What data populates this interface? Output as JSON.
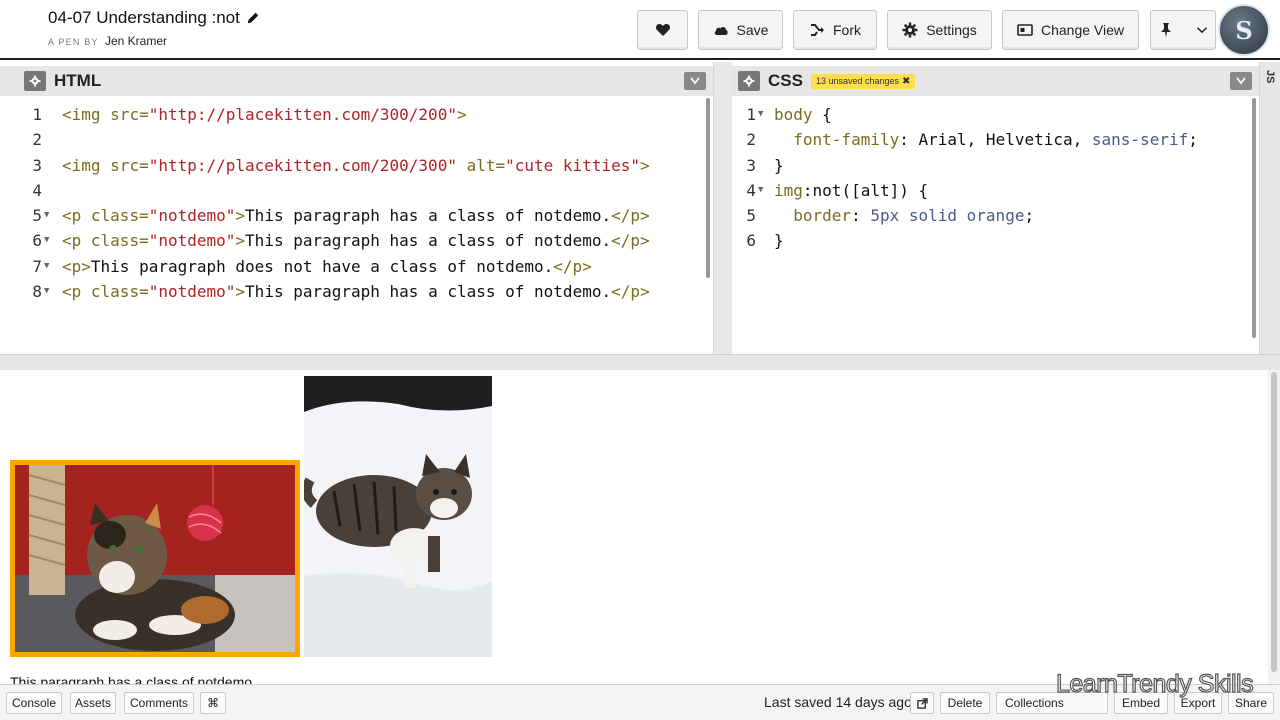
{
  "pen": {
    "title": "04-07 Understanding :not",
    "byline_prefix": "A PEN BY",
    "author": "Jen Kramer"
  },
  "header_buttons": {
    "save": "Save",
    "fork": "Fork",
    "settings": "Settings",
    "change_view": "Change View"
  },
  "avatar_text": "S",
  "html_editor": {
    "title": "HTML",
    "lines": [
      {
        "n": "1",
        "segments": [
          [
            "tag",
            "<img "
          ],
          [
            "attr",
            "src="
          ],
          [
            "str",
            "\"http://placekitten.com/300/200\""
          ],
          [
            "tag",
            ">"
          ]
        ]
      },
      {
        "n": "2",
        "segments": []
      },
      {
        "n": "3",
        "segments": [
          [
            "tag",
            "<img "
          ],
          [
            "attr",
            "src="
          ],
          [
            "str",
            "\"http://placekitten.com/200/300\""
          ],
          [
            "attr",
            " alt="
          ],
          [
            "str",
            "\"cute kitties\""
          ],
          [
            "tag",
            ">"
          ]
        ]
      },
      {
        "n": "4",
        "segments": []
      },
      {
        "n": "5",
        "segments": [
          [
            "tag",
            "<p "
          ],
          [
            "attr",
            "class="
          ],
          [
            "str",
            "\"notdemo\""
          ],
          [
            "tag",
            ">"
          ],
          [
            "plain",
            "This paragraph has a class of notdemo."
          ],
          [
            "tag",
            "</p>"
          ]
        ]
      },
      {
        "n": "6",
        "segments": [
          [
            "tag",
            "<p "
          ],
          [
            "attr",
            "class="
          ],
          [
            "str",
            "\"notdemo\""
          ],
          [
            "tag",
            ">"
          ],
          [
            "plain",
            "This paragraph has a class of notdemo."
          ],
          [
            "tag",
            "</p>"
          ]
        ]
      },
      {
        "n": "7",
        "segments": [
          [
            "tag",
            "<p>"
          ],
          [
            "plain",
            "This paragraph does not have a class of notdemo."
          ],
          [
            "tag",
            "</p>"
          ]
        ]
      },
      {
        "n": "8",
        "segments": [
          [
            "tag",
            "<p "
          ],
          [
            "attr",
            "class="
          ],
          [
            "str",
            "\"notdemo\""
          ],
          [
            "tag",
            ">"
          ],
          [
            "plain",
            "This paragraph has a class of notdemo."
          ],
          [
            "tag",
            "</p>"
          ]
        ]
      }
    ]
  },
  "css_editor": {
    "title": "CSS",
    "unsaved_badge": "13 unsaved changes",
    "lines": [
      {
        "n": "1",
        "segments": [
          [
            "sel",
            "body"
          ],
          [
            "plain",
            " {"
          ]
        ]
      },
      {
        "n": "2",
        "segments": [
          [
            "plain",
            "  "
          ],
          [
            "prop",
            "font-family"
          ],
          [
            "plain",
            ": Arial, Helvetica, "
          ],
          [
            "val",
            "sans-serif"
          ],
          [
            "plain",
            ";"
          ]
        ]
      },
      {
        "n": "3",
        "segments": [
          [
            "plain",
            "}"
          ]
        ]
      },
      {
        "n": "4",
        "segments": [
          [
            "sel",
            "img"
          ],
          [
            "plain",
            ":not([alt]) {"
          ]
        ]
      },
      {
        "n": "5",
        "segments": [
          [
            "plain",
            "  "
          ],
          [
            "prop",
            "border"
          ],
          [
            "plain",
            ": "
          ],
          [
            "val",
            "5px solid orange"
          ],
          [
            "plain",
            ";"
          ]
        ]
      },
      {
        "n": "6",
        "segments": [
          [
            "plain",
            "}"
          ]
        ]
      }
    ]
  },
  "js_tab": "JS",
  "preview": {
    "paragraph": "This paragraph has a class of notdemo."
  },
  "footer": {
    "console": "Console",
    "assets": "Assets",
    "comments": "Comments",
    "shortcut": "⌘",
    "last_saved": "Last saved 14 days ago",
    "delete": "Delete",
    "collections": "Collections",
    "embed": "Embed",
    "export": "Export",
    "share": "Share"
  },
  "watermark": "LearnTrendy Skills",
  "colors": {
    "orange_border": "#ffa500",
    "unsaved_badge": "#ffdd4c"
  }
}
